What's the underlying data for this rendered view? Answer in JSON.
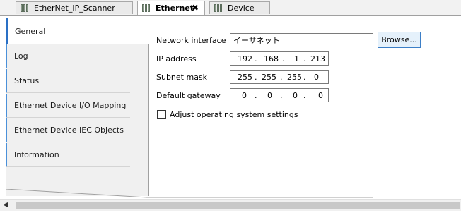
{
  "tabs": [
    {
      "label": "EtherNet_IP_Scanner",
      "icon": "device-icon"
    },
    {
      "label": "Ethernet",
      "icon": "device-icon",
      "close": "✖"
    },
    {
      "label": "Device",
      "icon": "device-icon"
    }
  ],
  "nav": {
    "items": [
      {
        "label": "General"
      },
      {
        "label": "Log"
      },
      {
        "label": "Status"
      },
      {
        "label": "Ethernet Device I/O Mapping"
      },
      {
        "label": "Ethernet Device IEC Objects"
      },
      {
        "label": "Information"
      }
    ]
  },
  "form": {
    "network_interface_label": "Network interface",
    "network_interface_value": "イーサネット",
    "browse_label": "Browse...",
    "ip_label": "IP address",
    "ip": [
      "192",
      "168",
      "1",
      "213"
    ],
    "subnet_label": "Subnet mask",
    "subnet": [
      "255",
      "255",
      "255",
      "0"
    ],
    "gateway_label": "Default gateway",
    "gateway": [
      "0",
      "0",
      "0",
      "0"
    ],
    "dot": ".",
    "adjust_label": "Adjust operating system settings",
    "adjust_checked": false
  },
  "scrollbar": {
    "left_arrow": "◀"
  }
}
